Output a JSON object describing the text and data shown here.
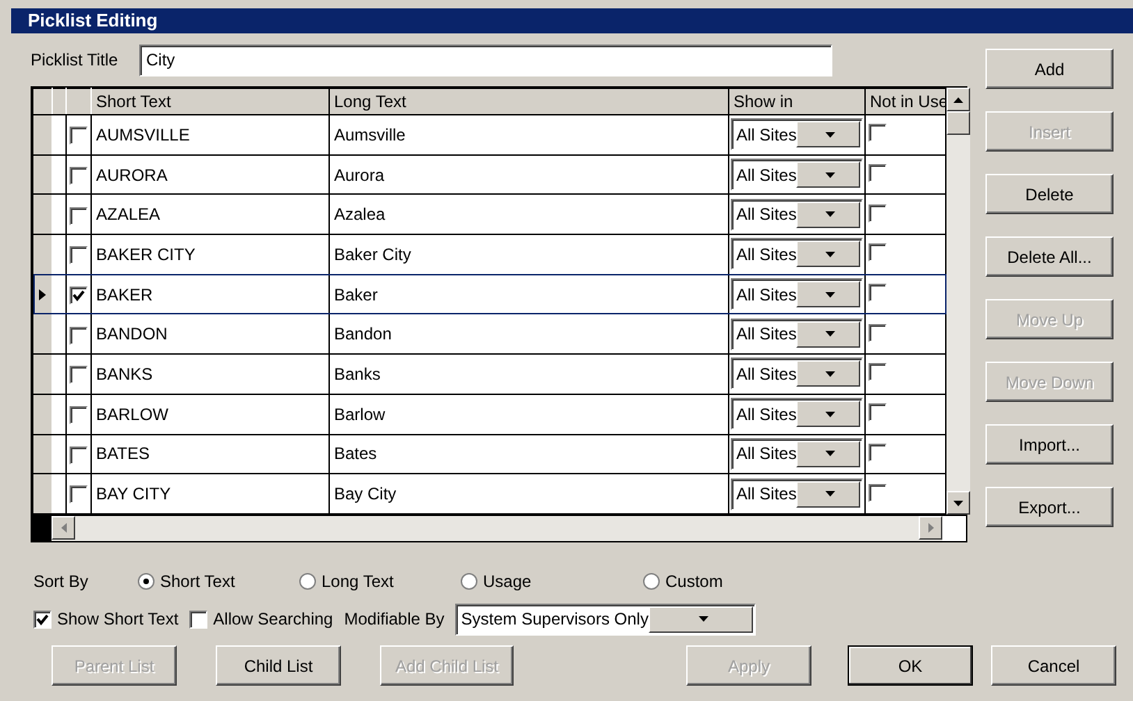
{
  "window": {
    "title": "Picklist Editing"
  },
  "picklist_title": {
    "label": "Picklist Title",
    "value": "City"
  },
  "table": {
    "columns": [
      "Short Text",
      "Long Text",
      "Show in",
      "Not in Use"
    ],
    "rows": [
      {
        "current": false,
        "checked": false,
        "short_text": "AUMSVILLE",
        "long_text": "Aumsville",
        "show_in": "All Sites",
        "not_in_use": false
      },
      {
        "current": false,
        "checked": false,
        "short_text": "AURORA",
        "long_text": "Aurora",
        "show_in": "All Sites",
        "not_in_use": false
      },
      {
        "current": false,
        "checked": false,
        "short_text": "AZALEA",
        "long_text": "Azalea",
        "show_in": "All Sites",
        "not_in_use": false
      },
      {
        "current": false,
        "checked": false,
        "short_text": "BAKER CITY",
        "long_text": "Baker City",
        "show_in": "All Sites",
        "not_in_use": false
      },
      {
        "current": true,
        "checked": true,
        "short_text": "BAKER",
        "long_text": "Baker",
        "show_in": "All Sites",
        "not_in_use": false
      },
      {
        "current": false,
        "checked": false,
        "short_text": "BANDON",
        "long_text": "Bandon",
        "show_in": "All Sites",
        "not_in_use": false
      },
      {
        "current": false,
        "checked": false,
        "short_text": "BANKS",
        "long_text": "Banks",
        "show_in": "All Sites",
        "not_in_use": false
      },
      {
        "current": false,
        "checked": false,
        "short_text": "BARLOW",
        "long_text": "Barlow",
        "show_in": "All Sites",
        "not_in_use": false
      },
      {
        "current": false,
        "checked": false,
        "short_text": "BATES",
        "long_text": "Bates",
        "show_in": "All Sites",
        "not_in_use": false
      },
      {
        "current": false,
        "checked": false,
        "short_text": "BAY CITY",
        "long_text": "Bay City",
        "show_in": "All Sites",
        "not_in_use": false
      }
    ]
  },
  "side_buttons": [
    {
      "label": "Add",
      "disabled": false
    },
    {
      "label": "Insert",
      "disabled": true
    },
    {
      "label": "Delete",
      "disabled": false
    },
    {
      "label": "Delete All...",
      "disabled": false
    },
    {
      "label": "Move Up",
      "disabled": true
    },
    {
      "label": "Move Down",
      "disabled": true
    },
    {
      "label": "Import...",
      "disabled": false
    },
    {
      "label": "Export...",
      "disabled": false
    }
  ],
  "sort_by": {
    "label": "Sort By",
    "options": [
      {
        "label": "Short Text",
        "selected": true
      },
      {
        "label": "Long Text",
        "selected": false
      },
      {
        "label": "Usage",
        "selected": false
      },
      {
        "label": "Custom",
        "selected": false
      }
    ]
  },
  "options": [
    {
      "label": "Show Short Text",
      "checked": true
    },
    {
      "label": "Allow Searching",
      "checked": false
    }
  ],
  "modifiable_by": {
    "label": "Modifiable By",
    "value": "System Supervisors Only"
  },
  "bottom_buttons": [
    {
      "label": "Parent List",
      "disabled": true,
      "default": false
    },
    {
      "label": "Child List",
      "disabled": false,
      "default": false
    },
    {
      "label": "Add Child List",
      "disabled": true,
      "default": false
    },
    {
      "label": "Apply",
      "disabled": true,
      "default": false
    },
    {
      "label": "OK",
      "disabled": false,
      "default": true
    },
    {
      "label": "Cancel",
      "disabled": false,
      "default": false
    }
  ]
}
